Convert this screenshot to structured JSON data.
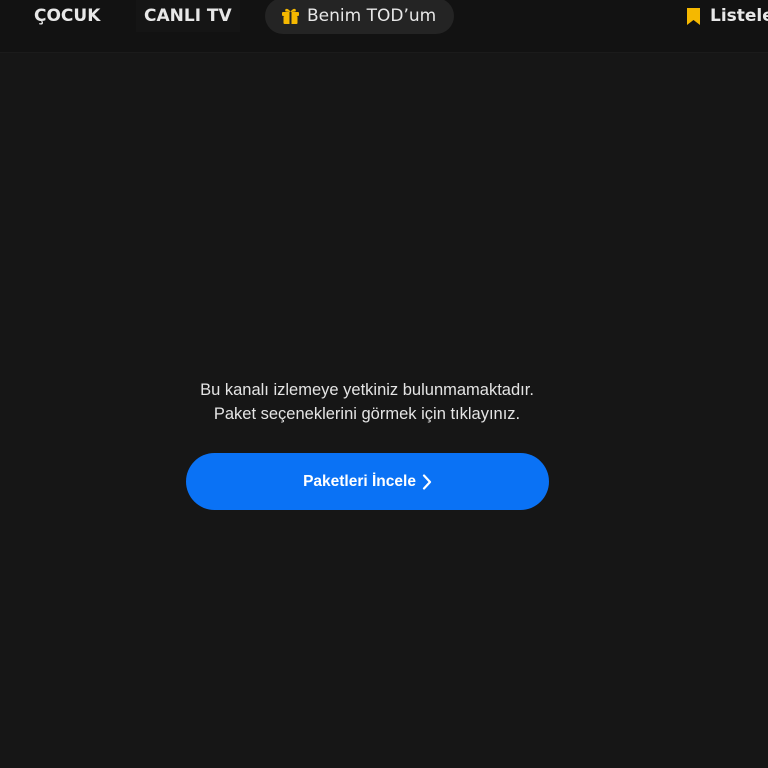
{
  "nav": {
    "cocuk": "ÇOCUK",
    "canli_tv": "CANLI TV",
    "benim_tod": "Benim TOD’um",
    "listele": "Listele"
  },
  "message": {
    "line1": "Bu kanalı izlemeye yetkiniz bulunmamaktadır.",
    "line2": "Paket seçeneklerini görmek için tıklayınız."
  },
  "cta": {
    "label": "Paketleri İncele"
  },
  "colors": {
    "background": "#161616",
    "topbar": "#121212",
    "accent_blue": "#0a72f5",
    "icon_gold": "#f5b800",
    "text": "#e4e4e4"
  },
  "icons": {
    "gift": "gift-icon",
    "bookmark": "bookmark-icon",
    "chevron": "chevron-right-icon"
  }
}
